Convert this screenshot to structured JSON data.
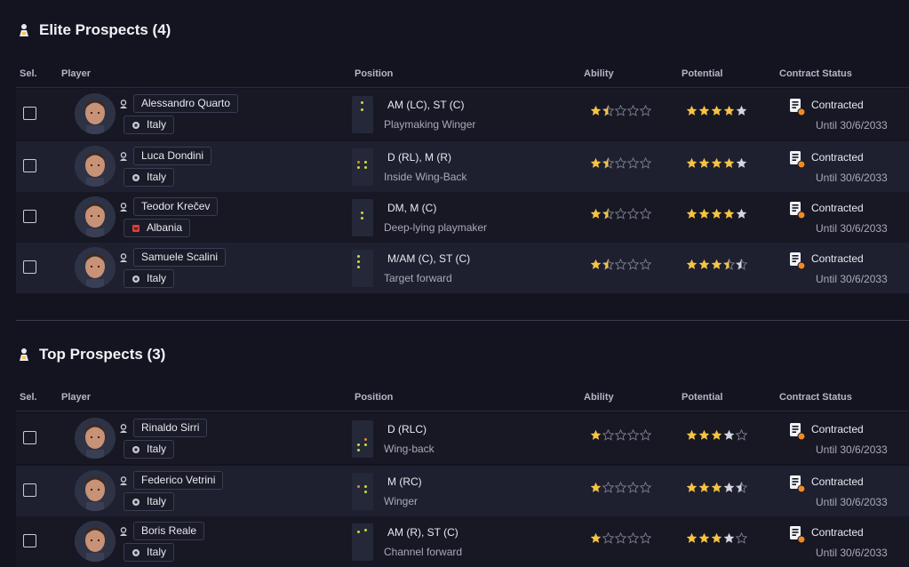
{
  "columns": {
    "sel": "Sel.",
    "player": "Player",
    "position": "Position",
    "ability": "Ability",
    "potential": "Potential",
    "contract": "Contract Status"
  },
  "colors": {
    "star_filled": "#f6c343",
    "star_potential": "#f6c343",
    "star_grey": "#d4d6de",
    "star_empty": "#7c7f8f",
    "position_green": "#c8e03a",
    "position_orange": "#f0842a",
    "accent_orange": "#f08a24"
  },
  "sections": [
    {
      "title": "Elite Prospects (4)",
      "players": [
        {
          "name": "Alessandro Quarto",
          "nation": "Italy",
          "position": "AM (LC), ST (C)",
          "role": "Playmaking Winger",
          "ability": 1.5,
          "potential": 4.0,
          "potential_grey": 1,
          "contract": "Contracted",
          "until": "Until 30/6/2033"
        },
        {
          "name": "Luca Dondini",
          "nation": "Italy",
          "position": "D (RL), M (R)",
          "role": "Inside Wing-Back",
          "ability": 1.5,
          "potential": 4.0,
          "potential_grey": 1,
          "contract": "Contracted",
          "until": "Until 30/6/2033"
        },
        {
          "name": "Teodor Krečev",
          "nation": "Albania",
          "position": "DM, M (C)",
          "role": "Deep-lying playmaker",
          "ability": 1.5,
          "potential": 4.0,
          "potential_grey": 1,
          "contract": "Contracted",
          "until": "Until 30/6/2033"
        },
        {
          "name": "Samuele Scalini",
          "nation": "Italy",
          "position": "M/AM (C), ST (C)",
          "role": "Target forward",
          "ability": 1.5,
          "potential": 3.5,
          "potential_grey": 1,
          "contract": "Contracted",
          "until": "Until 30/6/2033"
        }
      ]
    },
    {
      "title": "Top Prospects (3)",
      "players": [
        {
          "name": "Rinaldo Sirri",
          "nation": "Italy",
          "position": "D (RLC)",
          "role": "Wing-back",
          "ability": 1.0,
          "potential": 3.0,
          "potential_grey": 1,
          "contract": "Contracted",
          "until": "Until 30/6/2033"
        },
        {
          "name": "Federico Vetrini",
          "nation": "Italy",
          "position": "M (RC)",
          "role": "Winger",
          "ability": 1.0,
          "potential": 3.0,
          "potential_grey": 1.5,
          "contract": "Contracted",
          "until": "Until 30/6/2033"
        },
        {
          "name": "Boris Reale",
          "nation": "Italy",
          "position": "AM (R), ST (C)",
          "role": "Channel forward",
          "ability": 1.0,
          "potential": 3.0,
          "potential_grey": 1,
          "contract": "Contracted",
          "until": "Until 30/6/2033"
        }
      ]
    }
  ]
}
